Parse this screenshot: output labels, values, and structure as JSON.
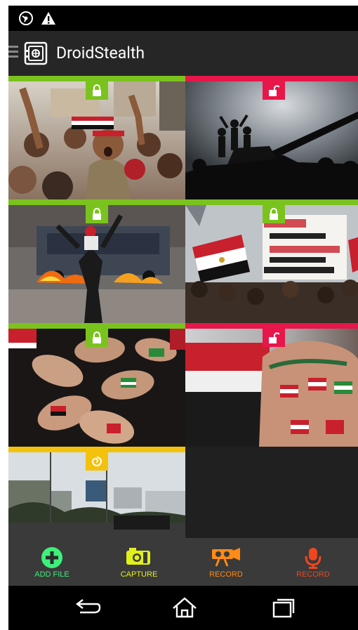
{
  "status_bar": {
    "icons": [
      "radio-signal-icon",
      "warning-icon"
    ]
  },
  "action_bar": {
    "title": "DroidStealth",
    "logo": "vault-icon",
    "menu": "hamburger-icon"
  },
  "grid": {
    "colors": {
      "locked": "#7ac31e",
      "unlocked": "#e8164a",
      "pending": "#f4c20d"
    },
    "tiles": [
      {
        "status": "locked",
        "icon": "lock-closed-icon",
        "scene": "crowd-protest"
      },
      {
        "status": "unlocked",
        "icon": "lock-open-icon",
        "scene": "tank-silhouette"
      },
      {
        "status": "locked",
        "icon": "lock-closed-icon",
        "scene": "fire-street"
      },
      {
        "status": "locked",
        "icon": "lock-closed-icon",
        "scene": "flags-banner"
      },
      {
        "status": "locked",
        "icon": "lock-closed-icon",
        "scene": "painted-hands"
      },
      {
        "status": "unlocked",
        "icon": "lock-open-icon",
        "scene": "painted-fist"
      },
      {
        "status": "pending",
        "icon": "spinner-icon",
        "scene": "city-street"
      }
    ]
  },
  "bottom_bar": {
    "actions": [
      {
        "label": "ADD FILE",
        "icon": "plus-circle-icon",
        "color": "#3ef07a"
      },
      {
        "label": "CAPTURE",
        "icon": "camera-icon",
        "color": "#e2f01a"
      },
      {
        "label": "RECORD",
        "icon": "video-camera-icon",
        "color": "#ff8a14"
      },
      {
        "label": "RECORD",
        "icon": "microphone-icon",
        "color": "#f0461e"
      }
    ]
  },
  "nav_bar": {
    "icons": [
      "back-icon",
      "home-icon",
      "recents-icon"
    ]
  }
}
